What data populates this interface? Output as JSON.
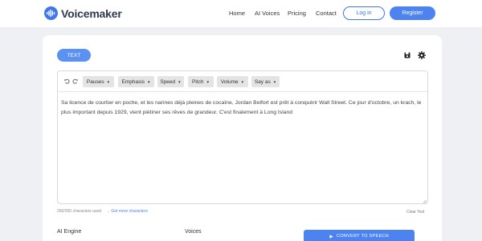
{
  "header": {
    "brand": "Voicemaker",
    "nav": [
      "Home",
      "AI Voices",
      "Pricing",
      "Contact"
    ],
    "login_label": "Log in",
    "register_label": "Register"
  },
  "editor": {
    "tab_label": "TEXT",
    "toolbar": [
      "Pauses",
      "Emphasis",
      "Speed",
      "Pitch",
      "Volume",
      "Say as"
    ],
    "content": "Sa licence de courtier en poche, et les narines déjà pleines de cocaïne, Jordan Belfort est prêt à conquérir Wall Street. Ce jour d'octobre, un krach, le plus important depuis 1929, vient piétiner ses rêves de grandeur. C'est finalement à Long Island",
    "char_count": "250/250 characters used",
    "more_chars_link": "→ Get more characters",
    "clear_label": "Clear Text"
  },
  "footer": {
    "ai_engine_label": "AI Engine",
    "voices_label": "Voices",
    "convert_label": "CONVERT TO SPEECH"
  },
  "colors": {
    "accent": "#4d83f0",
    "background": "#eef0f3",
    "card": "#ffffff",
    "tool_button": "#e4e4e4"
  }
}
